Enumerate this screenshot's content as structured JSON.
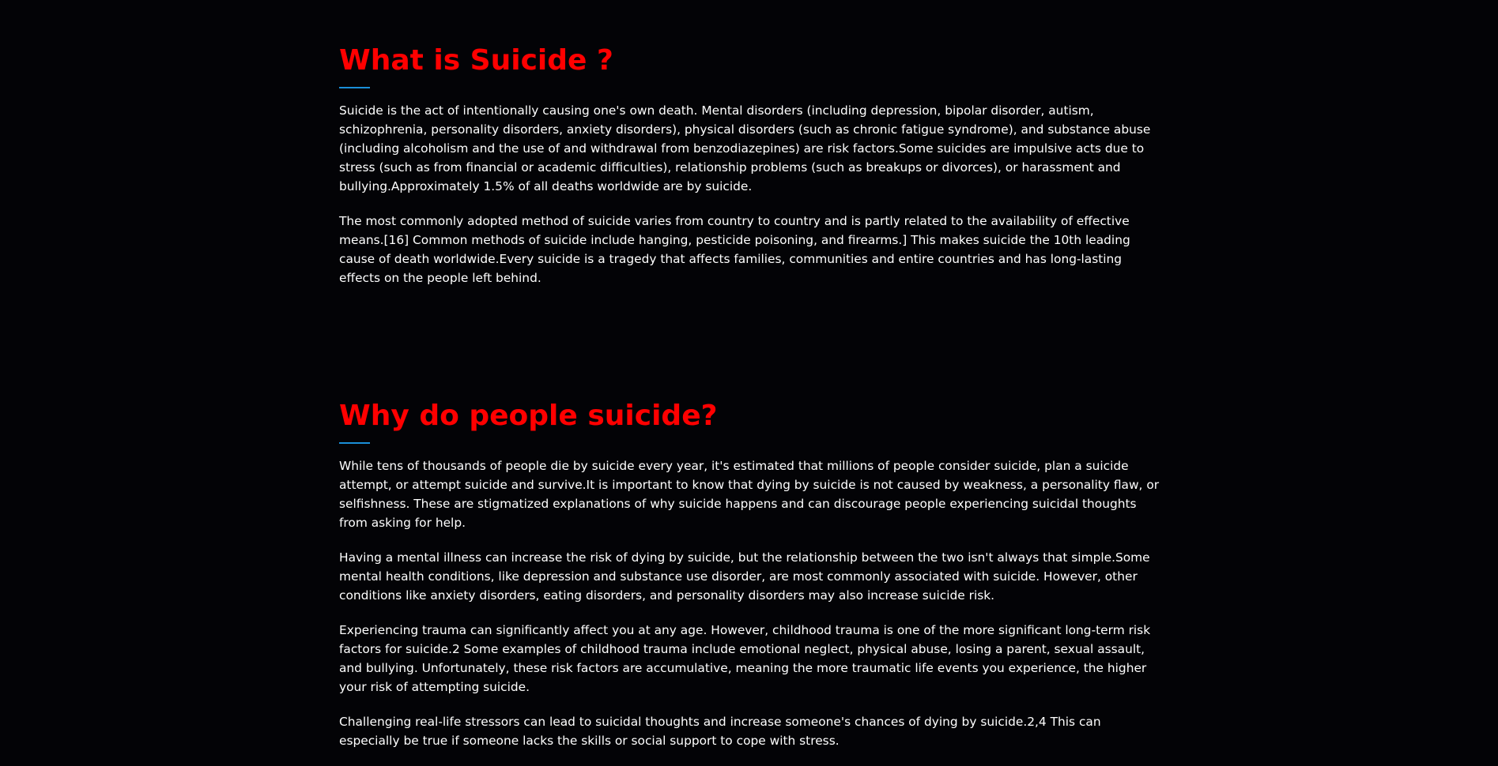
{
  "sections": [
    {
      "title": "What is Suicide ?",
      "paragraphs": [
        "Suicide is the act of intentionally causing one's own death. Mental disorders (including depression, bipolar disorder, autism, schizophrenia, personality disorders, anxiety disorders), physical disorders (such as chronic fatigue syndrome), and substance abuse (including alcoholism and the use of and withdrawal from benzodiazepines) are risk factors.Some suicides are impulsive acts due to stress (such as from financial or academic difficulties), relationship problems (such as breakups or divorces), or harassment and bullying.Approximately 1.5% of all deaths worldwide are by suicide.",
        "The most commonly adopted method of suicide varies from country to country and is partly related to the availability of effective means.[16] Common methods of suicide include hanging, pesticide poisoning, and firearms.] This makes suicide the 10th leading cause of death worldwide.Every suicide is a tragedy that affects families, communities and entire countries and has long-lasting effects on the people left behind."
      ]
    },
    {
      "title": "Why do people suicide?",
      "paragraphs": [
        "While tens of thousands of people die by suicide every year, it's estimated that millions of people consider suicide, plan a suicide attempt, or attempt suicide and survive.It is important to know that dying by suicide is not caused by weakness, a personality flaw, or selfishness. These are stigmatized explanations of why suicide happens and can discourage people experiencing suicidal thoughts from asking for help.",
        "Having a mental illness can increase the risk of dying by suicide, but the relationship between the two isn't always that simple.Some mental health conditions, like depression and substance use disorder, are most commonly associated with suicide. However, other conditions like anxiety disorders, eating disorders, and personality disorders may also increase suicide risk.",
        "Experiencing trauma can significantly affect you at any age. However, childhood trauma is one of the more significant long-term risk factors for suicide.2 Some examples of childhood trauma include emotional neglect, physical abuse, losing a parent, sexual assault, and bullying. Unfortunately, these risk factors are accumulative, meaning the more traumatic life events you experience, the higher your risk of attempting suicide.",
        "Challenging real-life stressors can lead to suicidal thoughts and increase someone's chances of dying by suicide.2,4 This can especially be true if someone lacks the skills or social support to cope with stress."
      ]
    }
  ],
  "colors": {
    "background": "#030306",
    "heading": "#ff0000",
    "accent": "#1a8fd8",
    "text": "#ffffff"
  }
}
